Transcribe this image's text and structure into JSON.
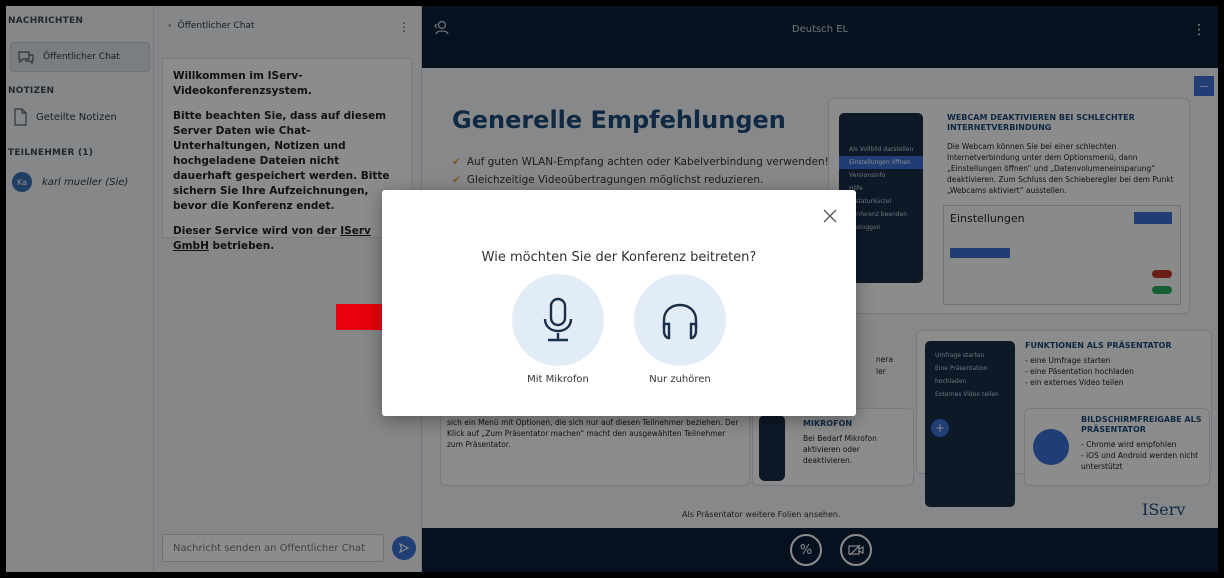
{
  "left_panel": {
    "messages_heading": "NACHRICHTEN",
    "public_chat": "Öffentlicher Chat",
    "notes_heading": "NOTIZEN",
    "shared_notes": "Geteilte Notizen",
    "participants_heading": "TEILNEHMER (1)",
    "user_initials": "Ka",
    "user_name": "karl mueller (Sie)"
  },
  "chat": {
    "header": "Öffentlicher Chat",
    "welcome_line1": "Willkommen im IServ-Videokonferenzsystem.",
    "welcome_line2": "Bitte beachten Sie, dass auf diesem Server Daten wie Chat-Unterhaltungen, Notizen und hochgeladene Dateien nicht dauerhaft gespeichert werden. Bitte sichern Sie Ihre Aufzeichnungen, bevor die Konferenz endet.",
    "welcome_line3_prefix": "Dieser Service wird von der ",
    "welcome_line3_link": "IServ GmbH",
    "welcome_line3_suffix": " betrieben.",
    "input_placeholder": "Nachricht senden an Öffentlicher Chat"
  },
  "topbar": {
    "title": "Deutsch EL"
  },
  "slide": {
    "title": "Generelle Empfehlungen",
    "bullet1": "Auf guten WLAN-Empfang achten oder Kabelverbindung verwenden!",
    "bullet2": "Gleichzeitige Videoübertragungen möglichst reduzieren.",
    "webcam_title": "WEBCAM DEAKTIVIEREN BEI SCHLECHTER INTERNETVERBINDUNG",
    "webcam_text": "Die Webcam können Sie bei einer schlechten Internetverbindung unter dem Optionsmenü, dann „Einstellungen öffnen“ und „Datenvolumeneinsparung“ deaktivieren. Zum Schluss den Schieberegler bei dem Punkt „Webcams aktiviert“ ausstellen.",
    "settings_title": "Einstellungen",
    "phone_items": [
      "Als Vollbild darstellen",
      "Einstellungen öffnen",
      "Versionsinfo",
      "Hilfe",
      "Tastaturkürzel",
      "Konferenz beenden",
      "Ausloggen"
    ],
    "presenter_title": "FUNKTIONEN ALS PRÄSENTATOR",
    "presenter_items": [
      "- eine Umfrage starten",
      "- eine Päsentation hochladen",
      "- ein externes Video teilen"
    ],
    "phone2_items": [
      "Umfrage starten",
      "Eine Präsentation hochladen",
      "Externes Video teilen"
    ],
    "mic_title": "MIKROFON",
    "mic_text": "Bei Bedarf Mikrofon aktivieren oder deaktivieren.",
    "screenshare_title": "BILDSCHIRMFREIGABE ALS PRÄSENTATOR",
    "screenshare_items": [
      "- Chrome wird empfohlen",
      "- iOS und Android werden nicht unterstützt"
    ],
    "participant_text": "sich ein Menü mit Optionen, die sich nur auf diesen Teilnehmer beziehen. Der Klick auf „Zum Präsentator machen“ macht den ausgewählten Teilnehmer zum Präsentator.",
    "partial_text_a": "nera",
    "partial_text_b": "ler",
    "more_slides": "Als Präsentator weitere Folien ansehen.",
    "logo": "IServ"
  },
  "modal": {
    "title": "Wie möchten Sie der Konferenz beitreten?",
    "mic_option": "Mit Mikrofon",
    "listen_option": "Nur zuhören"
  },
  "colors": {
    "topbar": "#0b1f3a",
    "accent": "#3b6fd8",
    "arrow": "#e8000b",
    "option_circle": "#e2ecf7"
  }
}
